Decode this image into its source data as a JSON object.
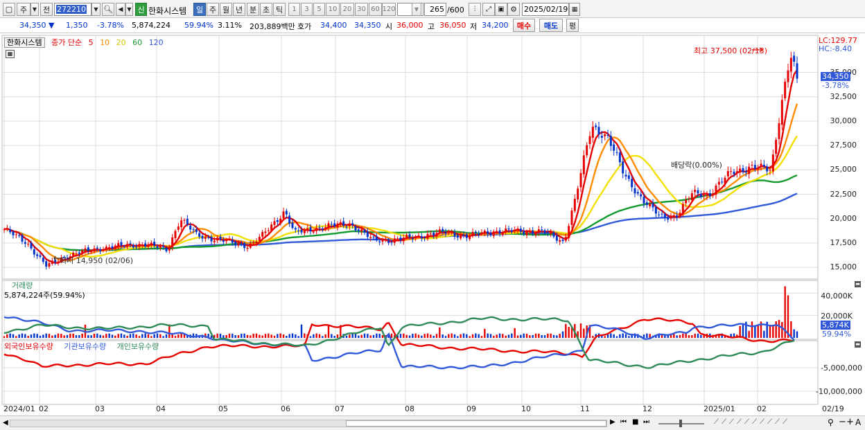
{
  "toolbar": {
    "market": "주",
    "prev": "전",
    "code": "272210",
    "stock_name": "한화시스템",
    "credit_badge": "신",
    "periods": [
      "일",
      "주",
      "월",
      "년",
      "분",
      "초",
      "틱"
    ],
    "intervals": [
      "1",
      "3",
      "5",
      "10",
      "20",
      "30",
      "60",
      "120"
    ],
    "count": "265",
    "count_max": "/600",
    "date": "2025/02/19"
  },
  "quote": {
    "price": "34,350 ▼",
    "change": "1,350",
    "change_pct": "-3.78%",
    "volume": "5,874,224",
    "volume_pct": "59.94%",
    "turnover_pct": "3.11%",
    "amount": "203,889백만",
    "ask_label": "호가",
    "ask": "34,400",
    "bid": "34,350",
    "open_label": "시",
    "open": "36,000",
    "high_label": "고",
    "high": "36,050",
    "low_label": "저",
    "low": "34,200",
    "buy": "매수",
    "sell": "매도",
    "eval": "평"
  },
  "price_panel": {
    "name_tag": "한화시스템",
    "legend_title": "종가 단순",
    "ma": [
      {
        "label": "5",
        "color": "#e60000"
      },
      {
        "label": "10",
        "color": "#ff8c00"
      },
      {
        "label": "20",
        "color": "#e6e600"
      },
      {
        "label": "60",
        "color": "#139a2e"
      },
      {
        "label": "120",
        "color": "#3058d8"
      }
    ],
    "lc": "LC:129.77",
    "hc": "HC:-8.40",
    "max_label": "최고 37,500 (02/13)",
    "min_label": "최저 14,950 (02/06)",
    "dividend_label": "배당락(0.00%)",
    "last_price": "34,350",
    "last_pct": "-3.78%",
    "y_ticks": [
      "35,000",
      "32,500",
      "30,000",
      "27,500",
      "25,000",
      "22,500",
      "20,000",
      "17,500",
      "15,000"
    ]
  },
  "volume_panel": {
    "title": "거래량",
    "value": "5,874,224주(59.94%)",
    "y_ticks": [
      "40,000K",
      "20,000K"
    ],
    "last": "5,874K",
    "last_pct": "59.94%"
  },
  "holding_panel": {
    "series": [
      {
        "name": "외국인보유수량",
        "color": "#e60000"
      },
      {
        "name": "기관보유수량",
        "color": "#3058d8"
      },
      {
        "name": "개인보유수량",
        "color": "#2e8b57"
      }
    ],
    "y_ticks": [
      "-5,000,000",
      "-10,000,000"
    ]
  },
  "x_axis": [
    "2024/01",
    "02",
    "03",
    "04",
    "05",
    "06",
    "07",
    "08",
    "09",
    "10",
    "11",
    "12",
    "2025/01",
    "02"
  ],
  "x_last": "02/19",
  "colors": {
    "up": "#e60000",
    "down": "#0033cc",
    "grid": "#dcdcdc"
  },
  "chart_data": [
    {
      "type": "candlestick",
      "title": "한화시스템",
      "series_ma": [
        "5",
        "10",
        "20",
        "60",
        "120"
      ],
      "ylim": [
        13800,
        38800
      ],
      "x": [
        "2024/01",
        "02",
        "03",
        "04",
        "05",
        "06",
        "07",
        "08",
        "09",
        "10",
        "11",
        "12",
        "2025/01",
        "02",
        "02/19"
      ],
      "close": [
        18800,
        15200,
        17200,
        17400,
        19500,
        17300,
        18800,
        21000,
        19200,
        18200,
        18500,
        28500,
        20500,
        25500,
        37000,
        34350
      ],
      "max": {
        "value": 37500,
        "date": "02/13"
      },
      "min": {
        "value": 14950,
        "date": "02/06"
      }
    },
    {
      "type": "bar",
      "title": "거래량",
      "ylim": [
        0,
        50000
      ],
      "unit": "K",
      "last": 5874
    },
    {
      "type": "line",
      "series": [
        {
          "name": "외국인보유수량"
        },
        {
          "name": "기관보유수량"
        },
        {
          "name": "개인보유수량"
        }
      ],
      "y_ticks": [
        -5000000,
        -10000000
      ]
    }
  ]
}
